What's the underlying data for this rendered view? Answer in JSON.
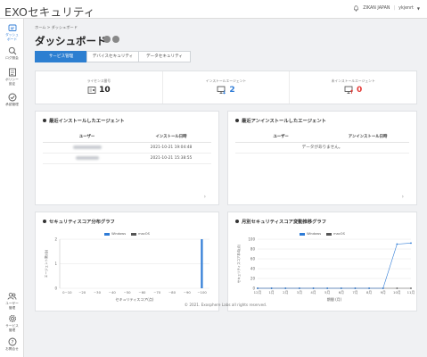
{
  "header": {
    "logo": "EXOセキュリティ",
    "company": "ZIKAN JAPAN",
    "user": "ykjenrt"
  },
  "sidebar": {
    "items": [
      {
        "label_l1": "ダッシュ",
        "label_l2": "ボード",
        "icon": "dashboard-icon"
      },
      {
        "label_l1": "ログ照会",
        "label_l2": "",
        "icon": "search-icon"
      },
      {
        "label_l1": "ポリシー",
        "label_l2": "設定",
        "icon": "policy-icon"
      },
      {
        "label_l1": "承認管理",
        "label_l2": "",
        "icon": "check-icon"
      },
      {
        "label_l1": "ユーザー",
        "label_l2": "管理",
        "icon": "users-icon"
      },
      {
        "label_l1": "サービス",
        "label_l2": "管理",
        "icon": "gear-icon"
      },
      {
        "label_l1": "お問合せ",
        "label_l2": "",
        "icon": "question-icon"
      }
    ]
  },
  "breadcrumb": "ホーム > ダッシュボード",
  "page_title": "ダッシュボード",
  "tabs": [
    {
      "label": "サービス管理"
    },
    {
      "label": "デバイスセキュリティ"
    },
    {
      "label": "データセキュリティ"
    }
  ],
  "stats": [
    {
      "label": "ライセンス番号",
      "value": "10"
    },
    {
      "label": "インストールエージェント",
      "value": "2"
    },
    {
      "label": "未インストールエージェント",
      "value": "0"
    }
  ],
  "recent_install": {
    "title": "最近インストールしたエージェント",
    "columns": [
      "ユーザー",
      "インストール日時"
    ],
    "rows": [
      {
        "date": "2021-10-21 19:04:48"
      },
      {
        "date": "2021-10-21 15:38:55"
      }
    ]
  },
  "recent_uninstall": {
    "title": "最近アンインストールしたエージェント",
    "columns": [
      "ユーザー",
      "アンインストール日時"
    ],
    "empty": "データがありません。"
  },
  "colors": {
    "windows": "#2e7bd6",
    "macos": "#555555",
    "accent": "#2d7fd1"
  },
  "chart_data": [
    {
      "type": "bar",
      "title": "セキュリティスコア分布グラフ",
      "series": [
        {
          "name": "Windows",
          "values": [
            0,
            0,
            0,
            0,
            0,
            0,
            0,
            0,
            0,
            2
          ]
        },
        {
          "name": "macOS",
          "values": [
            0,
            0,
            0,
            0,
            0,
            0,
            0,
            0,
            0,
            0
          ]
        }
      ],
      "categories": [
        "0~10",
        "~20",
        "~30",
        "~40",
        "~50",
        "~60",
        "~70",
        "~80",
        "~90",
        "~100"
      ],
      "xlabel": "セキュリティスコア(点)",
      "ylabel": "エージェント数(台)",
      "yticks": [
        "0",
        "1",
        "2"
      ],
      "ylim": [
        0,
        2
      ],
      "legend": "top-center"
    },
    {
      "type": "line",
      "title": "月別セキュリティスコア変動推移グラフ",
      "series": [
        {
          "name": "Windows",
          "values": [
            0,
            0,
            0,
            0,
            0,
            0,
            0,
            0,
            0,
            0,
            90,
            92
          ]
        },
        {
          "name": "macOS",
          "values": [
            0,
            0,
            0,
            0,
            0,
            0,
            0,
            0,
            0,
            0,
            0,
            0
          ]
        }
      ],
      "categories": [
        "12月",
        "1月",
        "2月",
        "3月",
        "4月",
        "5月",
        "6月",
        "7月",
        "8月",
        "9月",
        "10月",
        "11月"
      ],
      "xlabel": "期間 (月)",
      "ylabel": "セキュリティスコア平均(点)",
      "yticks": [
        "0",
        "20",
        "40",
        "60",
        "80",
        "100"
      ],
      "ylim": [
        0,
        100
      ],
      "legend": "top-center"
    }
  ],
  "footer": "© 2021. Exosphere Labs all rights reserved."
}
